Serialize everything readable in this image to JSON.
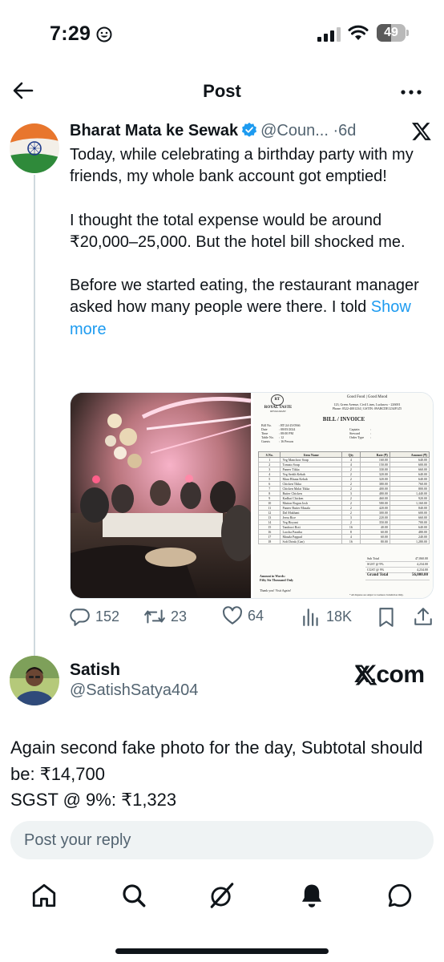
{
  "status_bar": {
    "time": "7:29",
    "battery_level": "49",
    "battery_fraction": 0.49
  },
  "header": {
    "title": "Post"
  },
  "post": {
    "author_name": "Bharat Mata ke Sewak",
    "handle": "@Coun...",
    "separator": "·",
    "age": "6d",
    "paragraphs": [
      "Today, while celebrating a birthday party with my friends, my whole bank account got emptied!",
      "I thought the total expense would be around ₹20,000–25,000. But the hotel bill shocked me.",
      "Before we started eating, the restaurant manager asked how many people were there. I told"
    ],
    "show_more": "Show more",
    "stats": {
      "replies": "152",
      "reposts": "23",
      "likes": "64",
      "views": "18K"
    },
    "invoice": {
      "tagline": "Good Food | Good Mood",
      "address": "123, Green Avenue, Civil Lines, Lucknow - 226001",
      "phone": "Phone: 0522-4001234 | GSTIN: 09ABCDE1234F1Z5",
      "logo_initials": "RT",
      "restaurant_name": "ROYAL TASTE",
      "restaurant_sub": "RESTAURANT",
      "title": "BILL / INVOICE",
      "meta": [
        {
          "label": "Bill No.",
          "value": ": RT/24-25/0566"
        },
        {
          "label": "Date",
          "value": ": 08/05/2024"
        },
        {
          "label": "Time",
          "value": ": 08:00 PM"
        },
        {
          "label": "Table No.",
          "value": ": 12"
        },
        {
          "label": "Guests",
          "value": ": 16 Person"
        }
      ],
      "meta_right": [
        {
          "label": "Captain",
          "value": ":"
        },
        {
          "label": "Steward",
          "value": ":"
        },
        {
          "label": "Order Type",
          "value": ":"
        }
      ],
      "columns": [
        "S.No.",
        "Item Name",
        "Qty",
        "Rate (₹)",
        "Amount (₹)"
      ],
      "items": [
        [
          "1",
          "Veg Manchow Soup",
          "4",
          "160.00",
          "640.00"
        ],
        [
          "2",
          "Tomato Soup",
          "4",
          "150.00",
          "600.00"
        ],
        [
          "3",
          "Paneer Tikka",
          "2",
          "330.00",
          "660.00"
        ],
        [
          "4",
          "Veg Seekh Kebab",
          "2",
          "320.00",
          "640.00"
        ],
        [
          "5",
          "Mara Bhuna Kebab",
          "2",
          "320.00",
          "640.00"
        ],
        [
          "6",
          "Chicken Tikka",
          "2",
          "380.00",
          "760.00"
        ],
        [
          "7",
          "Chicken Malai Tikka",
          "2",
          "400.00",
          "800.00"
        ],
        [
          "8",
          "Butter Chicken",
          "3",
          "480.00",
          "1,440.00"
        ],
        [
          "9",
          "Kadhai Chicken",
          "2",
          "460.00",
          "920.00"
        ],
        [
          "10",
          "Mutton Rogan Josh",
          "2",
          "580.00",
          "1,160.00"
        ],
        [
          "11",
          "Paneer Butter Masala",
          "2",
          "420.00",
          "840.00"
        ],
        [
          "12",
          "Dal Makhani",
          "2",
          "300.00",
          "600.00"
        ],
        [
          "13",
          "Jeera Rice",
          "3",
          "220.00",
          "660.00"
        ],
        [
          "14",
          "Veg Biryani",
          "2",
          "350.00",
          "700.00"
        ],
        [
          "15",
          "Tandoori Roti",
          "16",
          "40.00",
          "640.00"
        ],
        [
          "16",
          "Laccha Paratha",
          "8",
          "60.00",
          "480.00"
        ],
        [
          "17",
          "Masala Pappad",
          "4",
          "60.00",
          "240.00"
        ],
        [
          "18",
          "Soft Drink (Can)",
          "16",
          "80.00",
          "1,280.00"
        ]
      ],
      "totals": [
        {
          "label": "Sub Total",
          "value": "47,060.00"
        },
        {
          "label": "SGST @ 9%",
          "value": "4,234.00"
        },
        {
          "label": "CGST @ 9%",
          "value": "4,234.00"
        }
      ],
      "grand_total_label": "Grand Total",
      "grand_total_value": "56,000.00",
      "amount_words_label": "Amount in Words:",
      "amount_words": "Fifty Six Thousand Only",
      "thanks": "Thank you! Visit Again!",
      "disclaimer": "* All disputes are subject to Lucknow Jurisdiction Only."
    }
  },
  "reply": {
    "name": "Satish",
    "handle": "@SatishSatya404",
    "watermark": "X.com",
    "lines": [
      "Again second fake photo for the day, Subtotal should be: ₹14,700",
      "SGST @ 9%: ₹1,323"
    ]
  },
  "reply_box": {
    "placeholder": "Post your reply"
  },
  "icons": {
    "back": "arrow-left-icon",
    "more": "more-horizontal-icon",
    "home": "home-icon",
    "search": "search-icon",
    "grok": "grok-icon",
    "notifications": "bell-icon",
    "messages": "message-icon"
  },
  "colors": {
    "accent": "#1d9bf0",
    "text": "#0f1419",
    "secondary": "#536471",
    "reply_box": "#eff3f4"
  }
}
